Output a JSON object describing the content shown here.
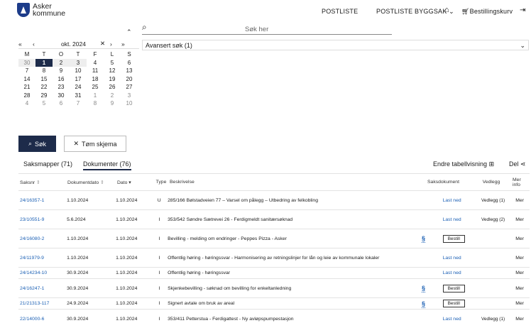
{
  "brand": {
    "line1": "Asker",
    "line2": "kommune"
  },
  "nav": {
    "postliste": "POSTLISTE",
    "byggsak": "POSTLISTE BYGGSAK",
    "cart": "Bestillingskurv"
  },
  "calendar": {
    "month": "okt. 2024",
    "weekdays": [
      "M",
      "T",
      "O",
      "T",
      "F",
      "L",
      "S"
    ],
    "days": [
      "30",
      "1",
      "2",
      "3",
      "4",
      "5",
      "6",
      "7",
      "8",
      "9",
      "10",
      "11",
      "12",
      "13",
      "14",
      "15",
      "16",
      "17",
      "18",
      "19",
      "20",
      "21",
      "22",
      "23",
      "24",
      "25",
      "26",
      "27",
      "28",
      "29",
      "30",
      "31",
      "1",
      "2",
      "3",
      "4",
      "5",
      "6",
      "7",
      "8",
      "9",
      "10"
    ]
  },
  "search": {
    "placeholder": "Søk her",
    "advanced": "Avansert søk (1)",
    "search_btn": "Søk",
    "clear_btn": "Tøm skjema"
  },
  "tabs": {
    "saksmapper": "Saksmapper (71)",
    "dokumenter": "Dokumenter (76)"
  },
  "table_tools": {
    "change_view": "Endre tabellvisning",
    "share": "Del"
  },
  "headers": {
    "saksnr": "Saksnr",
    "dokdato": "Dokumentdato",
    "dato": "Dato",
    "type": "Type",
    "beskr": "Beskrivelse",
    "saksdok": "Saksdokument",
    "vedlegg": "Vedlegg",
    "mer": "Mer info"
  },
  "rows": [
    {
      "saksnr": "24/16357-1",
      "dokdato": "1.10.2024",
      "dato": "1.10.2024",
      "type": "U",
      "beskr": "285/166 Bølstadveien 77 – Varsel om pålegg – Utbedring av felkobling",
      "action": "Last ned",
      "vedlegg": "Vedlegg (1)",
      "mer": "Mer",
      "para": ""
    },
    {
      "saksnr": "23/10551-9",
      "dokdato": "5.6.2024",
      "dato": "1.10.2024",
      "type": "I",
      "beskr": "353/542 Søndre Sætrevei 26 - Ferdigmeldt sanitærsøknad",
      "action": "Last ned",
      "vedlegg": "Vedlegg (2)",
      "mer": "Mer",
      "para": ""
    },
    {
      "saksnr": "24/16080-2",
      "dokdato": "1.10.2024",
      "dato": "1.10.2024",
      "type": "I",
      "beskr": "Bevilling - melding om endringer - Peppes Pizza - Asker",
      "action": "Bestill",
      "vedlegg": "",
      "mer": "Mer",
      "para": "§"
    },
    {
      "saksnr": "24/11979-9",
      "dokdato": "1.10.2024",
      "dato": "1.10.2024",
      "type": "I",
      "beskr": "Offentlig høring - høringssvar - Harmonisering av retningslinjer for lån og leie av kommunale lokaler",
      "action": "Last ned",
      "vedlegg": "",
      "mer": "Mer",
      "para": ""
    },
    {
      "saksnr": "24/14234-10",
      "dokdato": "30.9.2024",
      "dato": "1.10.2024",
      "type": "I",
      "beskr": "Offentlig høring - høringssvar",
      "action": "Last ned",
      "vedlegg": "",
      "mer": "Mer",
      "para": ""
    },
    {
      "saksnr": "24/16247-1",
      "dokdato": "30.9.2024",
      "dato": "1.10.2024",
      "type": "I",
      "beskr": "Skjenkebevilling - søknad om bevilling for enkeltanledning",
      "action": "Bestill",
      "vedlegg": "",
      "mer": "Mer",
      "para": "§"
    },
    {
      "saksnr": "21/21313-117",
      "dokdato": "24.9.2024",
      "dato": "1.10.2024",
      "type": "I",
      "beskr": "Signert avtale om bruk av areal",
      "action": "Bestill",
      "vedlegg": "",
      "mer": "Mer",
      "para": "§"
    },
    {
      "saksnr": "22/14000-6",
      "dokdato": "30.9.2024",
      "dato": "1.10.2024",
      "type": "I",
      "beskr": "353/411 Petterstua - Ferdigattest - Ny avløpspumpestasjon",
      "action": "Last ned",
      "vedlegg": "Vedlegg (1)",
      "mer": "Mer",
      "para": ""
    }
  ]
}
